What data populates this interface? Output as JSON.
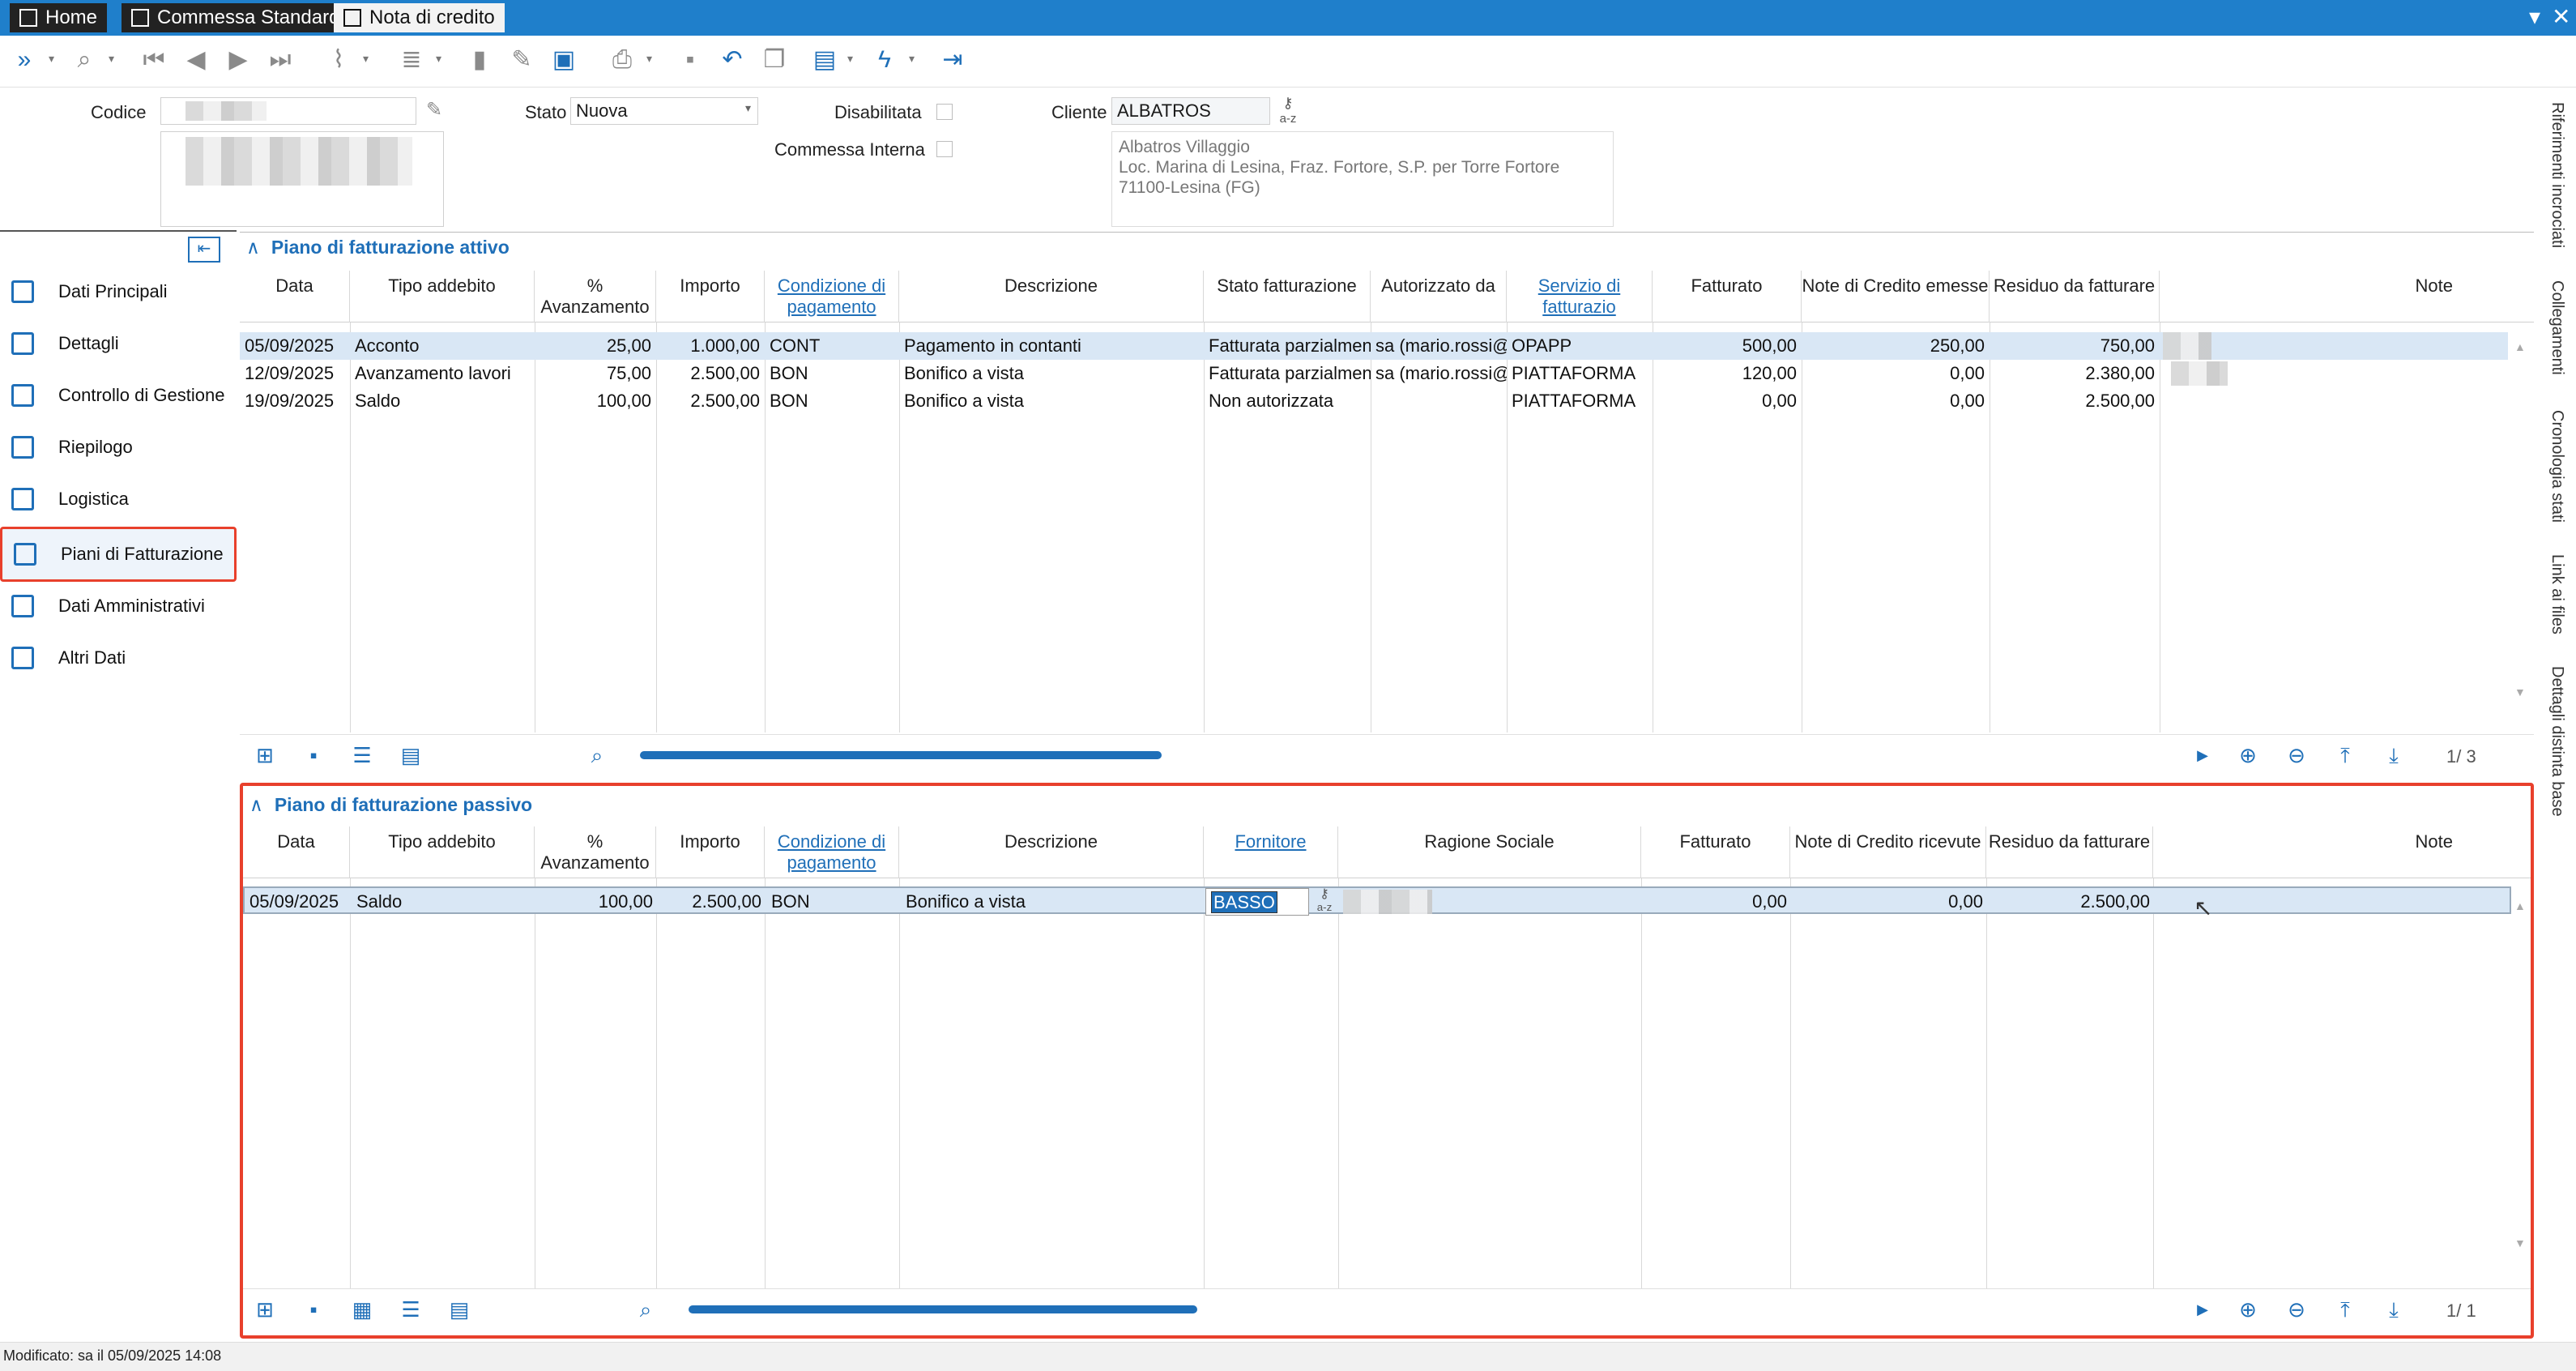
{
  "titlebar": {
    "tabs": [
      {
        "label": "Home",
        "icon": "home-icon"
      },
      {
        "label": "Commessa Standard",
        "icon": "window-icon"
      },
      {
        "label": "Nota di credito",
        "icon": "document-icon"
      }
    ],
    "controls": {
      "dropdown": "▾",
      "close": "✕"
    }
  },
  "header": {
    "codice_label": "Codice",
    "stato_label": "Stato",
    "stato_value": "Nuova",
    "disabilitata_label": "Disabilitata",
    "commessa_interna_label": "Commessa Interna",
    "cliente_label": "Cliente",
    "cliente_value": "ALBATROS",
    "address": [
      "Albatros Villaggio",
      "Loc. Marina di Lesina, Fraz. Fortore, S.P. per Torre Fortore",
      "71100-Lesina (FG)"
    ],
    "az_label": "a-z"
  },
  "sidebar": {
    "items": [
      {
        "label": "Dati Principali",
        "icon": "table-icon"
      },
      {
        "label": "Dettagli",
        "icon": "folder-icon"
      },
      {
        "label": "Controllo di Gestione",
        "icon": "search-doc-icon"
      },
      {
        "label": "Riepilogo",
        "icon": "summary-icon"
      },
      {
        "label": "Logistica",
        "icon": "box-icon"
      },
      {
        "label": "Piani di Fatturazione",
        "icon": "calculator-icon"
      },
      {
        "label": "Dati Amministrativi",
        "icon": "buildings-icon"
      },
      {
        "label": "Altri Dati",
        "icon": "add-doc-icon"
      }
    ],
    "selected": "Piani di Fatturazione"
  },
  "right_tabs": [
    "Riferimenti incrociati",
    "Collegamenti",
    "Cronologia stati",
    "Link ai files",
    "Dettagli distinta base"
  ],
  "attivo": {
    "title": "Piano di fatturazione attivo",
    "headers": [
      "Data",
      "Tipo addebito",
      "% Avanzamento",
      "Importo",
      "Condizione di pagamento",
      "Descrizione",
      "Stato fatturazione",
      "Autorizzato da",
      "Servizio di fatturazio",
      "Fatturato",
      "Note di Credito emesse",
      "Residuo da fatturare",
      "Note"
    ],
    "rows": [
      [
        "05/09/2025",
        "Acconto",
        "25,00",
        "1.000,00",
        "CONT",
        "Pagamento in contanti",
        "Fatturata parzialment",
        "sa (mario.rossi@",
        "OPAPP",
        "500,00",
        "250,00",
        "750,00"
      ],
      [
        "12/09/2025",
        "Avanzamento lavori",
        "75,00",
        "2.500,00",
        "BON",
        "Bonifico a vista",
        "Fatturata parzialment",
        "sa (mario.rossi@",
        "PIATTAFORMA",
        "120,00",
        "0,00",
        "2.380,00"
      ],
      [
        "19/09/2025",
        "Saldo",
        "100,00",
        "2.500,00",
        "BON",
        "Bonifico a vista",
        "Non autorizzata",
        "",
        "PIATTAFORMA",
        "0,00",
        "0,00",
        "2.500,00"
      ]
    ],
    "pager": "1/ 3"
  },
  "passivo": {
    "title": "Piano di fatturazione passivo",
    "headers": [
      "Data",
      "Tipo addebito",
      "% Avanzamento",
      "Importo",
      "Condizione di pagamento",
      "Descrizione",
      "Fornitore",
      "Ragione Sociale",
      "Fatturato",
      "Note di Credito ricevute",
      "Residuo da fatturare",
      "Note"
    ],
    "rows": [
      [
        "05/09/2025",
        "Saldo",
        "100,00",
        "2.500,00",
        "BON",
        "Bonifico a vista",
        "BASSO",
        "",
        "0,00",
        "0,00",
        "2.500,00"
      ]
    ],
    "pager": "1/ 1"
  },
  "status": "Modificato: sa il 05/09/2025 14:08",
  "colors": {
    "accent": "#1f6fb8",
    "highlight": "#e8402c",
    "titlebar": "#1f7fcb",
    "selected_row": "#d9e7f5"
  }
}
